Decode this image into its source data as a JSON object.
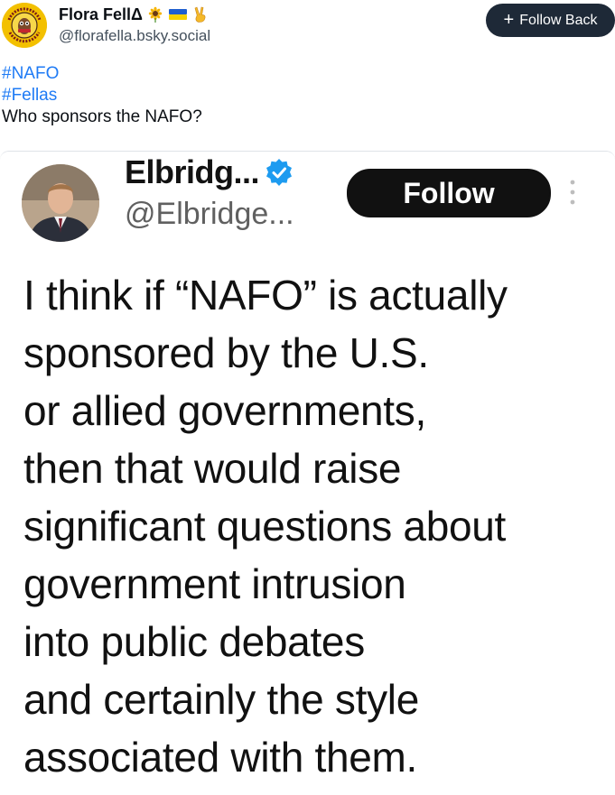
{
  "post": {
    "author": {
      "name": "Flora FellΔ",
      "handle": "@florafella.bsky.social",
      "avatar_text_top": "ЗАЙКІ ШЕРШНІ",
      "avatar_text_bottom": "WILD HORNETS"
    },
    "follow_back_label": "Follow Back",
    "hashtags": [
      "#NAFO",
      "#Fellas"
    ],
    "body": "Who sponsors the NAFO?"
  },
  "embedded_tweet": {
    "name": "Elbridg...",
    "handle": "@Elbridge...",
    "follow_label": "Follow",
    "lines": [
      "I think if “NAFO” is actually",
      "sponsored by the U.S.",
      "or allied governments,",
      "then that would raise",
      "significant questions about",
      "government intrusion",
      "into public debates",
      "and certainly the style",
      "associated with them."
    ]
  },
  "colors": {
    "link": "#1f7bf5",
    "follow_back_bg": "#1e2937",
    "verified": "#1d9bf0"
  },
  "icons": [
    "sunflower-emoji",
    "ukraine-flag-emoji",
    "victory-hand-emoji",
    "plus-icon",
    "verified-badge-icon",
    "more-vertical-icon"
  ]
}
